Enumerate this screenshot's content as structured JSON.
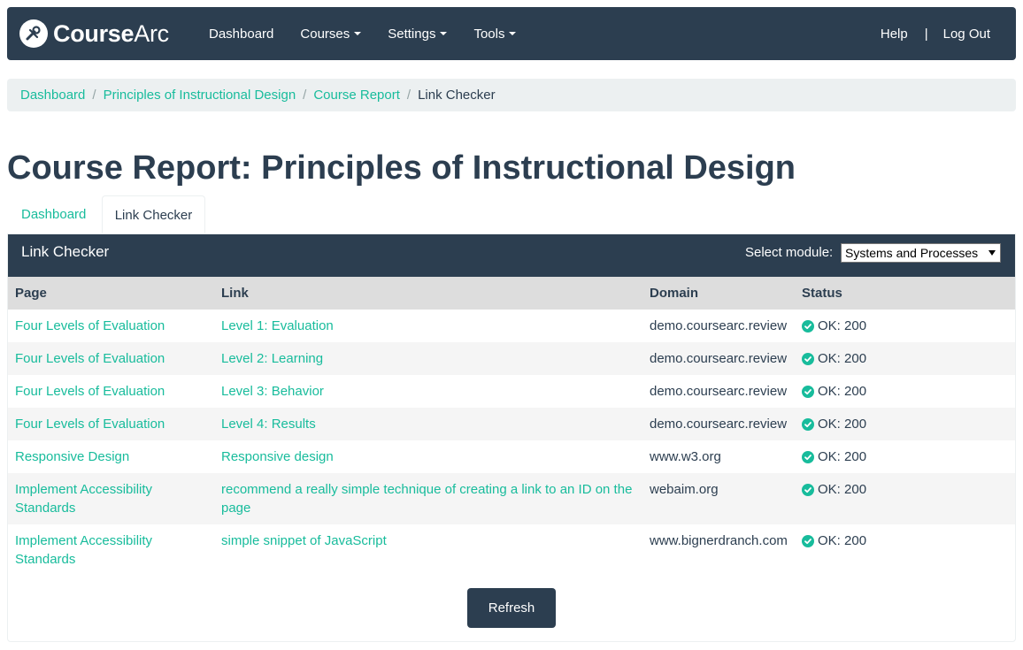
{
  "brand": {
    "name_bold": "Course",
    "name_light": "Arc",
    "icon": "wrench-icon"
  },
  "nav": {
    "left": [
      {
        "label": "Dashboard",
        "dropdown": false
      },
      {
        "label": "Courses",
        "dropdown": true
      },
      {
        "label": "Settings",
        "dropdown": true
      },
      {
        "label": "Tools",
        "dropdown": true
      }
    ],
    "help": "Help",
    "separator": "|",
    "logout": "Log Out"
  },
  "breadcrumb": {
    "items": [
      "Dashboard",
      "Principles of Instructional Design",
      "Course Report"
    ],
    "active": "Link Checker",
    "separator": "/"
  },
  "page_title": "Course Report: Principles of Instructional Design",
  "tabs": {
    "dashboard": "Dashboard",
    "link_checker": "Link Checker"
  },
  "panel": {
    "title": "Link Checker",
    "module_label": "Select module:",
    "module_selected": "Systems and Processes"
  },
  "table": {
    "headers": [
      "Page",
      "Link",
      "Domain",
      "Status"
    ],
    "rows": [
      {
        "page": "Four Levels of Evaluation",
        "link": "Level 1: Evaluation",
        "domain": "demo.coursearc.review",
        "status": "OK: 200"
      },
      {
        "page": "Four Levels of Evaluation",
        "link": "Level 2: Learning",
        "domain": "demo.coursearc.review",
        "status": "OK: 200"
      },
      {
        "page": "Four Levels of Evaluation",
        "link": "Level 3: Behavior",
        "domain": "demo.coursearc.review",
        "status": "OK: 200"
      },
      {
        "page": "Four Levels of Evaluation",
        "link": "Level 4: Results",
        "domain": "demo.coursearc.review",
        "status": "OK: 200"
      },
      {
        "page": "Responsive Design",
        "link": "Responsive design",
        "domain": "www.w3.org",
        "status": "OK: 200"
      },
      {
        "page": "Implement Accessibility Standards",
        "link": "recommend a really simple technique of creating a link to an ID on the page",
        "domain": "webaim.org",
        "status": "OK: 200"
      },
      {
        "page": "Implement Accessibility Standards",
        "link": "simple snippet of JavaScript",
        "domain": "www.bignerdranch.com",
        "status": "OK: 200"
      }
    ]
  },
  "refresh_label": "Refresh",
  "colors": {
    "primary": "#2c3e50",
    "accent": "#18bc9c",
    "light_bg": "#ecf0f1",
    "header_bg": "#dddddd",
    "stripe": "#f5f5f5"
  }
}
